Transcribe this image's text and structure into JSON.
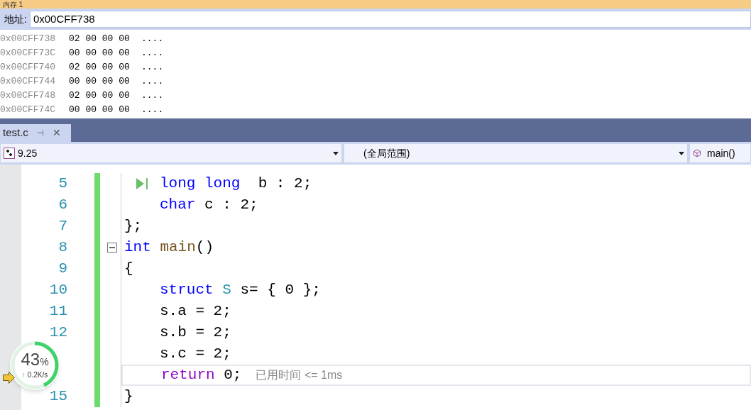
{
  "memory_window": {
    "title": "内存 1",
    "address_label": "地址:",
    "address_value": "0x00CFF738",
    "rows": [
      {
        "address": "0x00CFF738",
        "bytes": "02 00 00 00",
        "chars": "...."
      },
      {
        "address": "0x00CFF73C",
        "bytes": "00 00 00 00",
        "chars": "...."
      },
      {
        "address": "0x00CFF740",
        "bytes": "02 00 00 00",
        "chars": "...."
      },
      {
        "address": "0x00CFF744",
        "bytes": "00 00 00 00",
        "chars": "...."
      },
      {
        "address": "0x00CFF748",
        "bytes": "02 00 00 00",
        "chars": "...."
      },
      {
        "address": "0x00CFF74C",
        "bytes": "00 00 00 00",
        "chars": "...."
      }
    ]
  },
  "tabs": [
    {
      "label": "test.c",
      "selected": true,
      "pin": "⊣",
      "close": "✕"
    }
  ],
  "nav_bar": {
    "project": "9.25",
    "scope": "(全局范围)",
    "member": "main()"
  },
  "editor": {
    "lines": [
      {
        "children": [
          {
            "number": "5",
            "current": true,
            "fold": false,
            "highlighted": false,
            "tokens": [
              {
                "text": "long long",
                "kind": "keyword"
              },
              {
                "text": "  b : 2;",
                "kind": "plain"
              }
            ]
          },
          {
            "number": "6",
            "current": false,
            "fold": false,
            "highlighted": false,
            "tokens": [
              {
                "text": "char",
                "kind": "keyword"
              },
              {
                "text": " c : 2;",
                "kind": "plain"
              }
            ]
          }
        ]
      },
      {
        "number": "7",
        "current": false,
        "fold": false,
        "highlighted": false,
        "tokens": [
          {
            "text": "};",
            "kind": "plain"
          }
        ]
      },
      {
        "number": "8",
        "current": false,
        "fold": true,
        "highlighted": false,
        "tokens": [
          {
            "text": "int",
            "kind": "keyword"
          },
          {
            "text": " main",
            "kind": "function"
          },
          {
            "text": "()",
            "kind": "plain"
          }
        ]
      },
      {
        "number": "9",
        "current": false,
        "fold": false,
        "highlighted": false,
        "tokens": [
          {
            "text": "{",
            "kind": "plain"
          }
        ]
      },
      {
        "children": [
          {
            "number": "10",
            "current": false,
            "fold": false,
            "highlighted": false,
            "tokens": [
              {
                "text": "struct",
                "kind": "keyword"
              },
              {
                "text": " S",
                "kind": "type"
              },
              {
                "text": " s= { 0 };",
                "kind": "plain"
              }
            ]
          },
          {
            "number": "11",
            "current": false,
            "fold": false,
            "highlighted": false,
            "tokens": [
              {
                "text": "s.a = 2;",
                "kind": "plain"
              }
            ]
          },
          {
            "number": "12",
            "current": false,
            "fold": false,
            "highlighted": false,
            "tokens": [
              {
                "text": "s.b = 2;",
                "kind": "plain"
              }
            ]
          },
          {
            "current": false,
            "fold": false,
            "highlighted": false,
            "tokens": [
              {
                "text": "s.c = 2;",
                "kind": "plain"
              }
            ]
          },
          {
            "current": false,
            "fold": false,
            "highlighted": true,
            "tokens": [
              {
                "text": "return",
                "kind": "control"
              },
              {
                "text": " 0;",
                "kind": "plain"
              }
            ],
            "hint": "已用时间 <= 1ms"
          }
        ]
      },
      {
        "number": "15",
        "current": false,
        "fold": false,
        "highlighted": false,
        "tokens": [
          {
            "text": "}",
            "kind": "plain"
          }
        ]
      }
    ]
  },
  "speed_widget": {
    "percent": "43",
    "unit": "%",
    "arrow": "↑",
    "speed": "0.2K/s",
    "level": 0.43
  }
}
